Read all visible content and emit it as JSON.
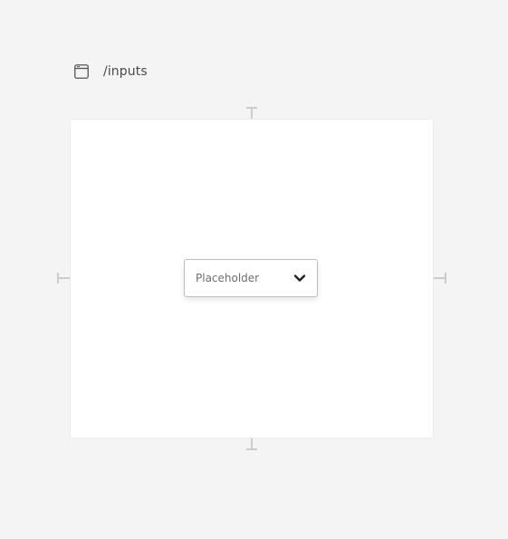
{
  "frame": {
    "title": "/inputs",
    "icon": "browser-window-icon"
  },
  "select": {
    "placeholder": "Placeholder",
    "icon": "chevron-down-icon"
  },
  "colors": {
    "background": "#f4f4f4",
    "canvas": "#ffffff",
    "border": "#bdbdbd",
    "marker": "#cccccc",
    "placeholder_text": "#6b6f73"
  }
}
